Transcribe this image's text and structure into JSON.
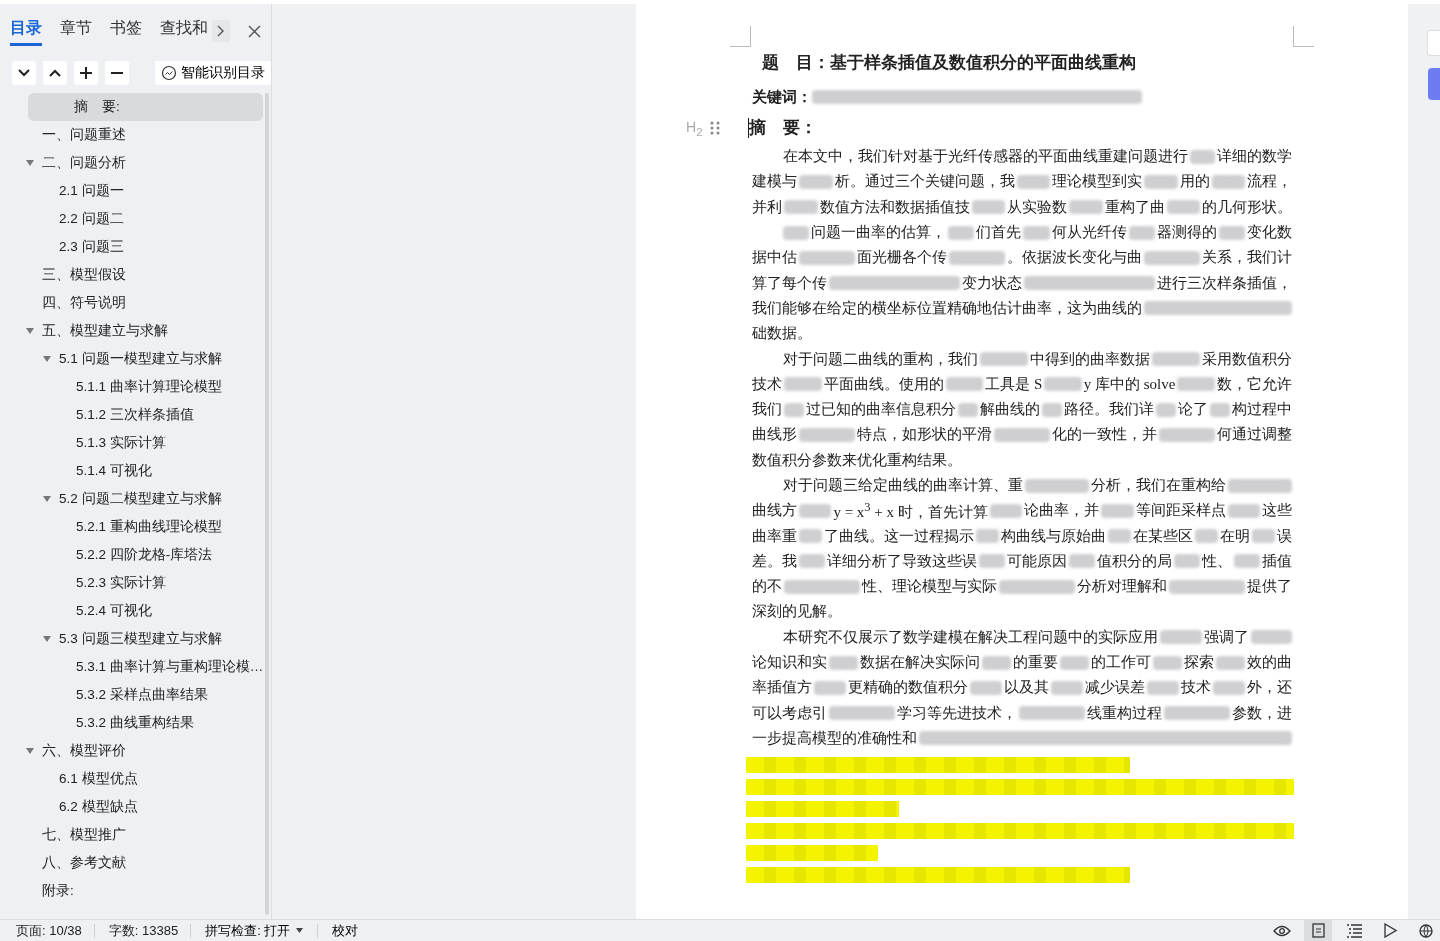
{
  "tabs": [
    {
      "label": "目录",
      "selected": true
    },
    {
      "label": "章节",
      "selected": false
    },
    {
      "label": "书签",
      "selected": false
    },
    {
      "label": "查找和",
      "selected": false
    }
  ],
  "smart_button": "智能识别目录",
  "toc": [
    {
      "label": "摘　要:",
      "selected": true
    },
    {
      "label": "一、问题重述",
      "selected": false
    },
    {
      "label": "二、问题分析",
      "selected": false,
      "expanded": true,
      "children": [
        {
          "label": "2.1 问题一",
          "selected": false
        },
        {
          "label": "2.2 问题二",
          "selected": false
        },
        {
          "label": "2.3 问题三",
          "selected": false
        }
      ]
    },
    {
      "label": "三、模型假设",
      "selected": false
    },
    {
      "label": "四、符号说明",
      "selected": false
    },
    {
      "label": "五、模型建立与求解",
      "selected": false,
      "expanded": true,
      "children": [
        {
          "label": "5.1 问题一模型建立与求解",
          "selected": false,
          "expanded": true,
          "children": [
            {
              "label": "5.1.1  曲率计算理论模型",
              "selected": false
            },
            {
              "label": "5.1.2  三次样条插值",
              "selected": false
            },
            {
              "label": "5.1.3  实际计算",
              "selected": false
            },
            {
              "label": "5.1.4  可视化",
              "selected": false
            }
          ]
        },
        {
          "label": "5.2 问题二模型建立与求解",
          "selected": false,
          "expanded": true,
          "children": [
            {
              "label": "5.2.1  重构曲线理论模型",
              "selected": false
            },
            {
              "label": "5.2.2  四阶龙格-库塔法",
              "selected": false
            },
            {
              "label": "5.2.3  实际计算",
              "selected": false
            },
            {
              "label": "5.2.4  可视化",
              "selected": false
            }
          ]
        },
        {
          "label": "5.3 问题三模型建立与求解",
          "selected": false,
          "expanded": true,
          "children": [
            {
              "label": "5.3.1  曲率计算与重构理论模…",
              "selected": false
            },
            {
              "label": "5.3.2  采样点曲率结果",
              "selected": false
            },
            {
              "label": "5.3.2  曲线重构结果",
              "selected": false
            }
          ]
        }
      ]
    },
    {
      "label": "六、模型评价",
      "selected": false,
      "expanded": true,
      "children": [
        {
          "label": "6.1  模型优点",
          "selected": false
        },
        {
          "label": "6.2  模型缺点",
          "selected": false
        }
      ]
    },
    {
      "label": "七、模型推广",
      "selected": false
    },
    {
      "label": "八、参考文献",
      "selected": false
    },
    {
      "label": "附录:",
      "selected": false
    }
  ],
  "document": {
    "title": "题　目：基于样条插值及数值积分的平面曲线重构",
    "keywords": [
      "关键词：",
      {
        "kind": "blur"
      }
    ],
    "heading_marker": "H$_{2}$",
    "heading": "摘　要：",
    "paragraphs": [
      [
        [
          "在本文中，我们针对基于光纤传感器的平面曲线重建问题进行",
          {
            "kind": "blur"
          },
          "详细的数学"
        ],
        [
          "建模与",
          {
            "kind": "blur"
          },
          "析。通过三个关键问题，我",
          {
            "kind": "blur"
          },
          "理论模型到实",
          {
            "kind": "blur"
          },
          "用的",
          {
            "kind": "blur"
          },
          "流程，"
        ],
        [
          "并利",
          {
            "kind": "blur"
          },
          "数值方法和数据插值技",
          {
            "kind": "blur"
          },
          "从实验数",
          {
            "kind": "blur"
          },
          "重构了曲",
          {
            "kind": "blur"
          },
          "的几何形状。"
        ]
      ],
      [
        [
          {
            "kind": "blur"
          },
          "问题一曲率的估算，",
          {
            "kind": "blur"
          },
          "们首先",
          {
            "kind": "blur"
          },
          "何从光纤传",
          {
            "kind": "blur"
          },
          "器测得的",
          {
            "kind": "blur"
          },
          "变化数"
        ],
        [
          "据中估",
          {
            "kind": "blur"
          },
          "面光栅各个传",
          {
            "kind": "blur"
          },
          "。依据波长变化与曲",
          {
            "kind": "blur"
          },
          "关系，我们计"
        ],
        [
          "算了每个传",
          {
            "kind": "blur"
          },
          "变力状态",
          {
            "kind": "blur"
          },
          "进行三次样条插值，"
        ],
        [
          "我们能够在给定的横坐标位置精确地估计曲率，这为曲线的",
          {
            "kind": "blur"
          }
        ],
        [
          "础数据。"
        ]
      ],
      [
        [
          "对于问题二曲线的重构，我们",
          {
            "kind": "blur"
          },
          "中得到的曲率数据",
          {
            "kind": "blur"
          },
          "采用数值积分"
        ],
        [
          "技术",
          {
            "kind": "blur"
          },
          "平面曲线。使用的",
          {
            "kind": "blur"
          },
          "工具是 S",
          {
            "kind": "blur"
          },
          "y 库中的 solve",
          {
            "kind": "blur"
          },
          "数，它允许"
        ],
        [
          "我们",
          {
            "kind": "blur"
          },
          "过已知的曲率信息积分",
          {
            "kind": "blur"
          },
          "解曲线的",
          {
            "kind": "blur"
          },
          "路径。我们详",
          {
            "kind": "blur"
          },
          "论了",
          {
            "kind": "blur"
          },
          "构过程中"
        ],
        [
          "曲线形",
          {
            "kind": "blur"
          },
          "特点，如形状的平滑",
          {
            "kind": "blur"
          },
          "化的一致性，并",
          {
            "kind": "blur"
          },
          "何通过调整"
        ],
        [
          "数值积分参数来优化重构结果。"
        ]
      ],
      [
        [
          "对于问题三给定曲线的曲率计算、重",
          {
            "kind": "blur"
          },
          "分析，我们在重构给",
          {
            "kind": "blur"
          }
        ],
        [
          "曲线方",
          {
            "kind": "blur"
          },
          "y = x$^{3}$ + x  时，首先计算",
          {
            "kind": "blur"
          },
          "论曲率，并",
          {
            "kind": "blur"
          },
          "等间距采样点",
          {
            "kind": "blur"
          },
          "这些"
        ],
        [
          "曲率重",
          {
            "kind": "blur"
          },
          "了曲线。这一过程揭示",
          {
            "kind": "blur"
          },
          "构曲线与原始曲",
          {
            "kind": "blur"
          },
          "在某些区",
          {
            "kind": "blur"
          },
          "在明",
          {
            "kind": "blur"
          },
          "误"
        ],
        [
          "差。我",
          {
            "kind": "blur"
          },
          "详细分析了导致这些误",
          {
            "kind": "blur"
          },
          "可能原因",
          {
            "kind": "blur"
          },
          "值积分的局",
          {
            "kind": "blur"
          },
          "性、",
          {
            "kind": "blur"
          },
          "插值"
        ],
        [
          "的不",
          {
            "kind": "blur"
          },
          "性、理论模型与实际",
          {
            "kind": "blur"
          },
          "分析对理解和",
          {
            "kind": "blur"
          },
          "提供了"
        ],
        [
          "深刻的见解。"
        ]
      ],
      [
        [
          "本研究不仅展示了数学建模在解决工程问题中的实际应用",
          {
            "kind": "blur"
          },
          "强调了",
          {
            "kind": "blur"
          }
        ],
        [
          "论知识和实",
          {
            "kind": "blur"
          },
          "数据在解决实际问",
          {
            "kind": "blur"
          },
          "的重要",
          {
            "kind": "blur"
          },
          "的工作可",
          {
            "kind": "blur"
          },
          "探索",
          {
            "kind": "blur"
          },
          "效的曲"
        ],
        [
          "率插值方",
          {
            "kind": "blur"
          },
          "更精确的数值积分",
          {
            "kind": "blur"
          },
          "以及其",
          {
            "kind": "blur"
          },
          "减少误差",
          {
            "kind": "blur"
          },
          "技术",
          {
            "kind": "blur"
          },
          "外，还"
        ],
        [
          "可以考虑引",
          {
            "kind": "blur"
          },
          "学习等先进技术，",
          {
            "kind": "blur"
          },
          "线重构过程",
          {
            "kind": "blur"
          },
          "参数，进"
        ],
        [
          "一步提高模型的准确性和",
          {
            "kind": "blur"
          }
        ]
      ]
    ],
    "highlighted_redaction": true
  },
  "status_bar": {
    "page": "页面: 10/38",
    "words": "字数: 13385",
    "spell_check": "拼写检查: 打开",
    "proofread": "校对",
    "views": [
      {
        "kind": "read",
        "selected": false
      },
      {
        "kind": "page",
        "selected": true
      },
      {
        "kind": "outline",
        "selected": false
      },
      {
        "kind": "play",
        "selected": false
      },
      {
        "kind": "web",
        "selected": false
      }
    ]
  }
}
